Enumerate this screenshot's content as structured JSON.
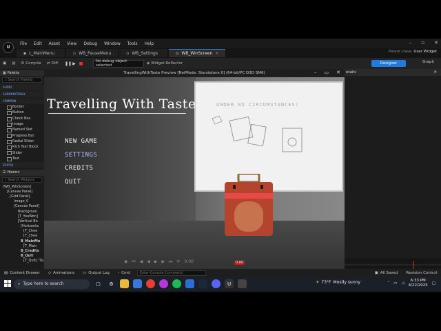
{
  "menubar": {
    "items": [
      "File",
      "Edit",
      "Asset",
      "View",
      "Debug",
      "Window",
      "Tools",
      "Help"
    ],
    "window_controls": [
      "–",
      "▫",
      "✕"
    ]
  },
  "tabs": [
    {
      "label": "L_MainMenu"
    },
    {
      "label": "WB_PauseMenu"
    },
    {
      "label": "WB_Settings"
    },
    {
      "label": "WB_WinScreen"
    }
  ],
  "parent_class": {
    "label": "Parent class:",
    "value": "User Widget"
  },
  "toolbar": {
    "compile": "Compile",
    "diff": "Diff",
    "debug_select": "No debug object selected",
    "widget_reflector": "Widget Reflector",
    "designer": "Designer",
    "graph": "Graph"
  },
  "palette": {
    "title": "Palette",
    "search_placeholder": "Search Palette",
    "categories": [
      "AUDIO",
      "AUDIOMATERIAL",
      "COMMON",
      "EDITOR"
    ],
    "items": [
      "Border",
      "Button",
      "Check Box",
      "Image",
      "Named Slot",
      "Progress Bar",
      "Radial Slider",
      "Rich Text Block",
      "Slider",
      "Text"
    ]
  },
  "hierarchy": {
    "title": "Hierarc",
    "search_placeholder": "Search Widgets",
    "items": [
      "[WB_WinScreen]",
      "[Canvas Panel]",
      "[Grid Panel]",
      "Image_0",
      "[Canvas Panel]",
      "Blackgroun",
      "[T_YouWon]",
      "[Vertical Bo",
      "[Horizonta",
      "[T_Chee",
      "[T_Chee",
      "B_MainMe",
      "[T_Main",
      "B_Credits",
      "B_Quit",
      "[T_Quit] \"Quit\""
    ]
  },
  "preview": {
    "title": "TravellingWithTaste Preview [NetMode: Standalone 0]  (64-bit/PC D3D SM6)",
    "controls": [
      "–",
      "▭",
      "✕"
    ],
    "game_title": "Travelling With Taste",
    "board_text": "UNDER NO CIRCUMSTANCES!",
    "menu": [
      "NEW GAME",
      "SETTINGS",
      "CREDITS",
      "QUIT"
    ],
    "selected_index": 1
  },
  "details": {
    "title": "etails"
  },
  "timeline": {
    "time_left": "0.00",
    "time_marker": "0.00"
  },
  "statusbar": {
    "content_drawer": "Content Drawer",
    "animations": "Animations",
    "output_log": "Output Log",
    "cmd": "Cmd",
    "cmd_placeholder": "Enter Console Command",
    "all_saved": "All Saved",
    "revision_control": "Revision Control"
  },
  "taskbar": {
    "search_placeholder": "Type here to search",
    "weather_temp": "73°F",
    "weather_desc": "Mostly sunny",
    "time": "6:33 PM",
    "date": "4/22/2025"
  },
  "colors": {
    "accent": "#1f7be0",
    "stop": "#e33333",
    "selected_menu": "#aec8ff"
  }
}
